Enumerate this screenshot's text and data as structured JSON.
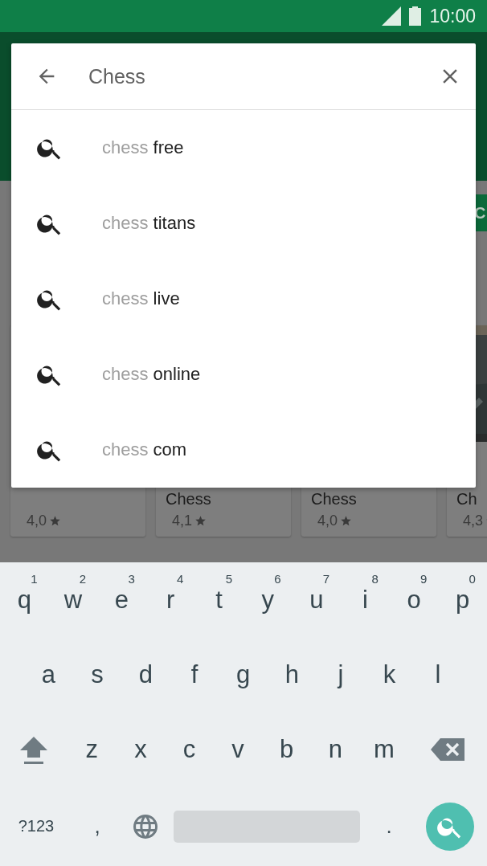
{
  "status_bar": {
    "time": "10:00"
  },
  "background": {
    "featured_button": "C",
    "cards": [
      {
        "rating": "4,0"
      },
      {
        "title_lines": [
          "Chess"
        ],
        "rating": "4,1"
      },
      {
        "title_lines": [
          "Chess"
        ],
        "rating": "4,0"
      },
      {
        "title_lines": [
          "Ch"
        ],
        "rating": "4,3"
      }
    ]
  },
  "search": {
    "query": "Chess",
    "suggestions": [
      {
        "prefix": "chess",
        "completion": "free"
      },
      {
        "prefix": "chess",
        "completion": "titans"
      },
      {
        "prefix": "chess",
        "completion": "live"
      },
      {
        "prefix": "chess",
        "completion": "online"
      },
      {
        "prefix": "chess",
        "completion": "com"
      }
    ]
  },
  "keyboard": {
    "rows": [
      [
        {
          "key": "q",
          "hint": "1"
        },
        {
          "key": "w",
          "hint": "2"
        },
        {
          "key": "e",
          "hint": "3"
        },
        {
          "key": "r",
          "hint": "4"
        },
        {
          "key": "t",
          "hint": "5"
        },
        {
          "key": "y",
          "hint": "6"
        },
        {
          "key": "u",
          "hint": "7"
        },
        {
          "key": "i",
          "hint": "8"
        },
        {
          "key": "o",
          "hint": "9"
        },
        {
          "key": "p",
          "hint": "0"
        }
      ],
      [
        {
          "key": "a"
        },
        {
          "key": "s"
        },
        {
          "key": "d"
        },
        {
          "key": "f"
        },
        {
          "key": "g"
        },
        {
          "key": "h"
        },
        {
          "key": "j"
        },
        {
          "key": "k"
        },
        {
          "key": "l"
        }
      ],
      [
        {
          "key": "z"
        },
        {
          "key": "x"
        },
        {
          "key": "c"
        },
        {
          "key": "v"
        },
        {
          "key": "b"
        },
        {
          "key": "n"
        },
        {
          "key": "m"
        }
      ]
    ],
    "symbols_key": "?123",
    "comma_key": ",",
    "period_key": "."
  }
}
